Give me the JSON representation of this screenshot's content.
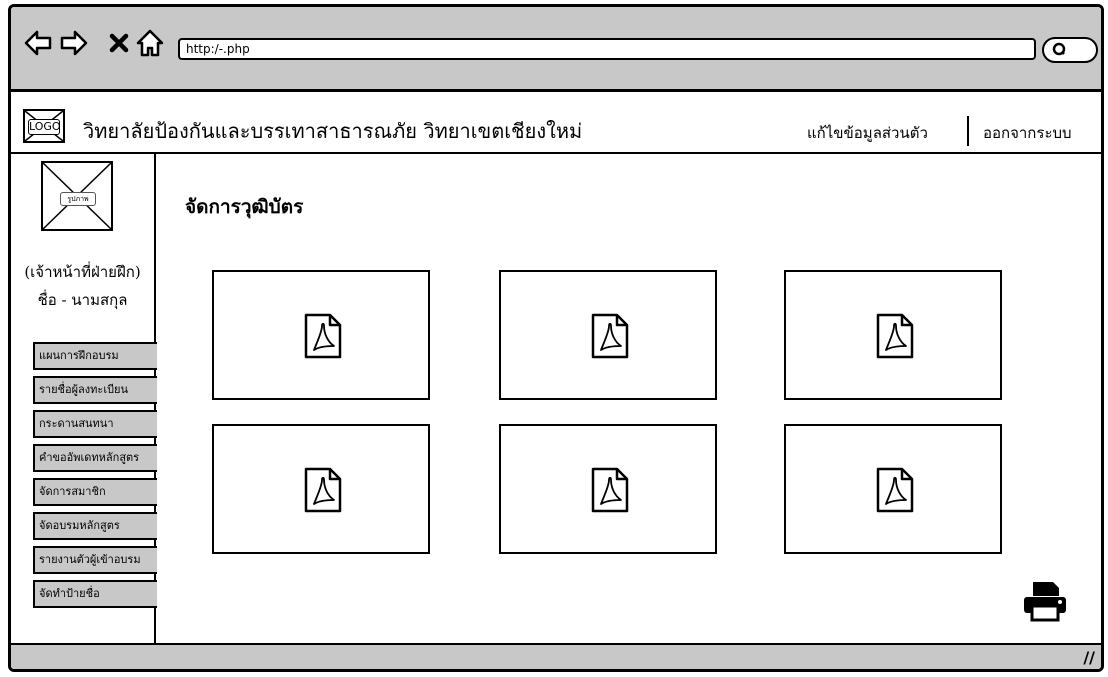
{
  "browser": {
    "url": "http:/-.php",
    "nav_icons": [
      "back-arrow-icon",
      "forward-arrow-icon",
      "stop-x-icon",
      "home-icon",
      "search-icon"
    ]
  },
  "header": {
    "logo_text": "LOGO",
    "site_title": "วิทยาลัยป้องกันและบรรเทาสาธารณภัย วิทยาเขตเชียงใหม่",
    "edit_profile": "แก้ไขข้อมูลส่วนตัว",
    "logout": "ออกจากระบบ"
  },
  "sidebar": {
    "avatar_label": "รูปภาพ",
    "role": "(เจ้าหน้าที่ฝ่ายฝึก)",
    "name": "ชื่อ - นามสกุล",
    "menu": [
      {
        "label": "แผนการฝึกอบรม"
      },
      {
        "label": "รายชื่อผู้ลงทะเบียน"
      },
      {
        "label": "กระดานสนทนา"
      },
      {
        "label": "คำขออัพเดทหลักสูตร"
      },
      {
        "label": "จัดการสมาชิก"
      },
      {
        "label": "จัดอบรมหลักสูตร"
      },
      {
        "label": "รายงานตัวผู้เข้าอบรม"
      },
      {
        "label": "จัดทำป้ายชื่อ"
      }
    ]
  },
  "main": {
    "title": "จัดการวุฒิบัตร",
    "certificates": [
      {
        "icon": "pdf-file-icon"
      },
      {
        "icon": "pdf-file-icon"
      },
      {
        "icon": "pdf-file-icon"
      },
      {
        "icon": "pdf-file-icon"
      },
      {
        "icon": "pdf-file-icon"
      },
      {
        "icon": "pdf-file-icon"
      }
    ],
    "print_icon": "printer-icon"
  },
  "colors": {
    "chrome_gray": "#c8c8c8",
    "border": "#000000",
    "background": "#ffffff"
  }
}
